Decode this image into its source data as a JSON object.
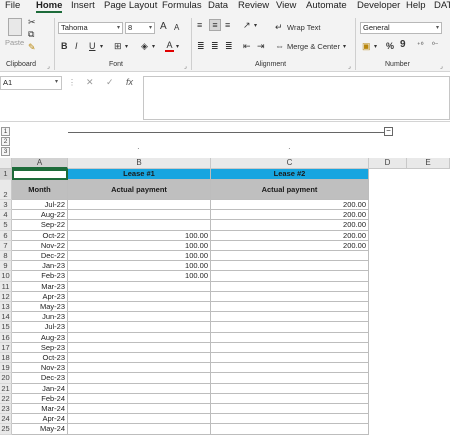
{
  "menu": [
    "File",
    "Home",
    "Insert",
    "Page Layout",
    "Formulas",
    "Data",
    "Review",
    "View",
    "Automate",
    "Developer",
    "Help",
    "DAT"
  ],
  "ribbon": {
    "clipboard_label": "Clipboard",
    "paste_label": "Paste",
    "font_label": "Font",
    "font_name": "Tahoma",
    "font_size": "8",
    "bold": "B",
    "italic": "I",
    "underline": "U",
    "font_color_glyph": "A",
    "grow_font": "A",
    "shrink_font": "A",
    "alignment_label": "Alignment",
    "wrap_text": "Wrap Text",
    "merge_center": "Merge & Center",
    "number_label": "Number",
    "number_format": "General",
    "percent": "%",
    "comma": "9"
  },
  "formula_bar": {
    "name_box": "A1",
    "cancel": "✕",
    "enter": "✓",
    "fx": "fx",
    "content": ""
  },
  "outline": {
    "levels": [
      "1",
      "2",
      "3"
    ],
    "collapse": "−",
    "dots": [
      "·",
      "·"
    ]
  },
  "columns": [
    "A",
    "B",
    "C",
    "D",
    "E"
  ],
  "headers": {
    "lease1": "Lease #1",
    "lease2": "Lease #2",
    "month": "Month",
    "actual1": "Actual payment",
    "actual2": "Actual payment"
  },
  "rows": [
    {
      "n": "3",
      "month": "Jul-22",
      "l1": "",
      "l2": "200.00"
    },
    {
      "n": "4",
      "month": "Aug-22",
      "l1": "",
      "l2": "200.00"
    },
    {
      "n": "5",
      "month": "Sep-22",
      "l1": "",
      "l2": "200.00"
    },
    {
      "n": "6",
      "month": "Oct-22",
      "l1": "100.00",
      "l2": "200.00"
    },
    {
      "n": "7",
      "month": "Nov-22",
      "l1": "100.00",
      "l2": "200.00"
    },
    {
      "n": "8",
      "month": "Dec-22",
      "l1": "100.00",
      "l2": ""
    },
    {
      "n": "9",
      "month": "Jan-23",
      "l1": "100.00",
      "l2": ""
    },
    {
      "n": "10",
      "month": "Feb-23",
      "l1": "100.00",
      "l2": ""
    },
    {
      "n": "11",
      "month": "Mar-23",
      "l1": "",
      "l2": ""
    },
    {
      "n": "12",
      "month": "Apr-23",
      "l1": "",
      "l2": ""
    },
    {
      "n": "13",
      "month": "May-23",
      "l1": "",
      "l2": ""
    },
    {
      "n": "14",
      "month": "Jun-23",
      "l1": "",
      "l2": ""
    },
    {
      "n": "15",
      "month": "Jul-23",
      "l1": "",
      "l2": ""
    },
    {
      "n": "16",
      "month": "Aug-23",
      "l1": "",
      "l2": ""
    },
    {
      "n": "17",
      "month": "Sep-23",
      "l1": "",
      "l2": ""
    },
    {
      "n": "18",
      "month": "Oct-23",
      "l1": "",
      "l2": ""
    },
    {
      "n": "19",
      "month": "Nov-23",
      "l1": "",
      "l2": ""
    },
    {
      "n": "20",
      "month": "Dec-23",
      "l1": "",
      "l2": ""
    },
    {
      "n": "21",
      "month": "Jan-24",
      "l1": "",
      "l2": ""
    },
    {
      "n": "22",
      "month": "Feb-24",
      "l1": "",
      "l2": ""
    },
    {
      "n": "23",
      "month": "Mar-24",
      "l1": "",
      "l2": ""
    },
    {
      "n": "24",
      "month": "Apr-24",
      "l1": "",
      "l2": ""
    },
    {
      "n": "25",
      "month": "May-24",
      "l1": "",
      "l2": ""
    }
  ],
  "colors": {
    "accent": "#1d6b3a",
    "lease_header": "#17a5e0",
    "subheader": "#bfbfbf"
  }
}
